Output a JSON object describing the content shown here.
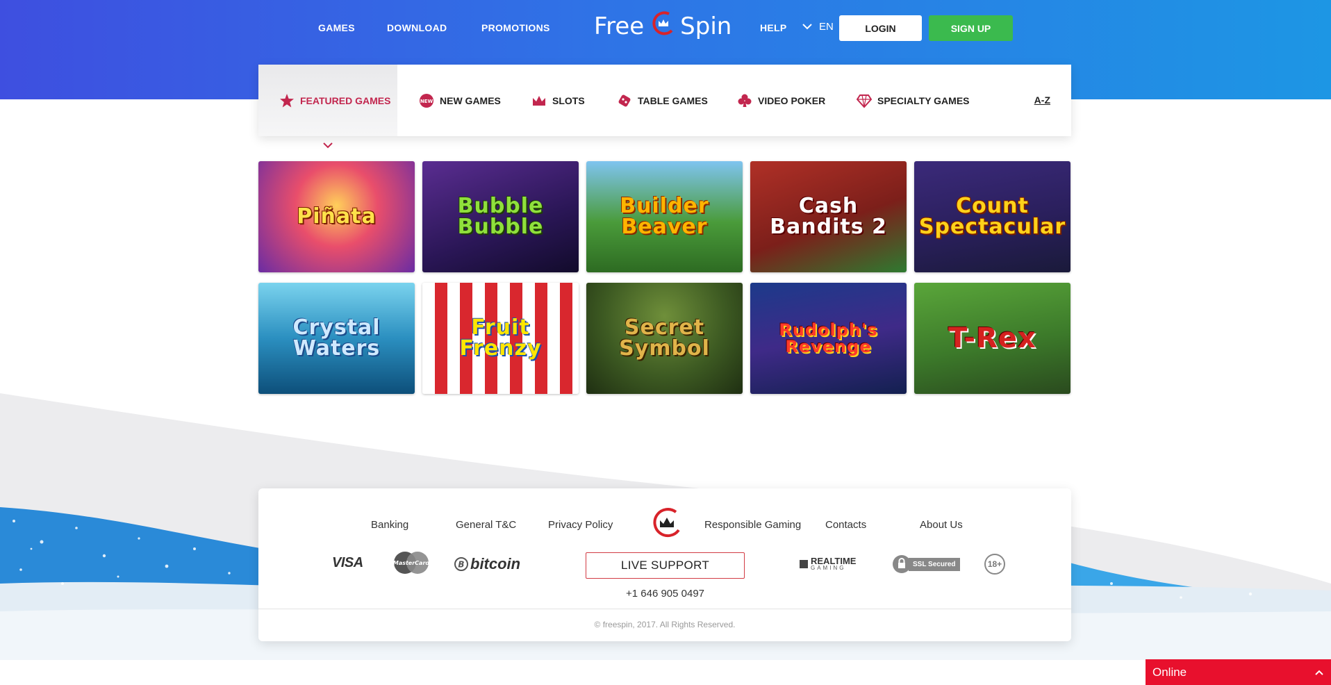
{
  "header": {
    "nav": [
      {
        "label": "GAMES"
      },
      {
        "label": "DOWNLOAD"
      },
      {
        "label": "PROMOTIONS"
      },
      {
        "label": "HELP"
      }
    ],
    "logo": {
      "word1": "Free",
      "word2": "Spin"
    },
    "language": "EN",
    "login_label": "LOGIN",
    "signup_label": "SIGN UP"
  },
  "tabs": {
    "items": [
      {
        "label": "FEATURED GAMES",
        "icon": "star-icon",
        "active": true
      },
      {
        "label": "NEW GAMES",
        "icon": "new-badge-icon",
        "active": false
      },
      {
        "label": "SLOTS",
        "icon": "crown-icon",
        "active": false
      },
      {
        "label": "TABLE GAMES",
        "icon": "dice-icon",
        "active": false
      },
      {
        "label": "VIDEO POKER",
        "icon": "club-icon",
        "active": false
      },
      {
        "label": "SPECIALTY GAMES",
        "icon": "diamond-icon",
        "active": false
      }
    ],
    "az_label": "A-Z"
  },
  "games": [
    {
      "title": "Piñata"
    },
    {
      "title": "Bubble Bubble"
    },
    {
      "title": "Builder Beaver"
    },
    {
      "title": "Cash Bandits 2"
    },
    {
      "title": "Count Spectacular"
    },
    {
      "title": "Crystal Waters"
    },
    {
      "title": "Fruit Frenzy"
    },
    {
      "title": "Secret Symbol"
    },
    {
      "title": "Rudolph's Revenge"
    },
    {
      "title": "T-Rex"
    }
  ],
  "footer": {
    "links": [
      {
        "label": "Banking"
      },
      {
        "label": "General T&C"
      },
      {
        "label": "Privacy Policy"
      },
      {
        "label": "Responsible Gaming"
      },
      {
        "label": "Contacts"
      },
      {
        "label": "About Us"
      }
    ],
    "payments": {
      "visa": "VISA",
      "mastercard": "MasterCard",
      "bitcoin": "bitcoin"
    },
    "live_support_label": "LIVE SUPPORT",
    "phone": "+1 646 905 0497",
    "badges": {
      "realtime": "REALTIME",
      "realtime_sub": "GAMING",
      "ssl": "SSL Secured",
      "age": "18+"
    },
    "copyright": "© freespin, 2017. All Rights Reserved."
  },
  "chat": {
    "status_label": "Online"
  },
  "colors": {
    "accent_red": "#c2264e",
    "signup_green": "#3bba4e",
    "hero_blue_start": "#3e4fe0",
    "hero_blue_end": "#1d96e4",
    "chat_red": "#e8102d"
  }
}
